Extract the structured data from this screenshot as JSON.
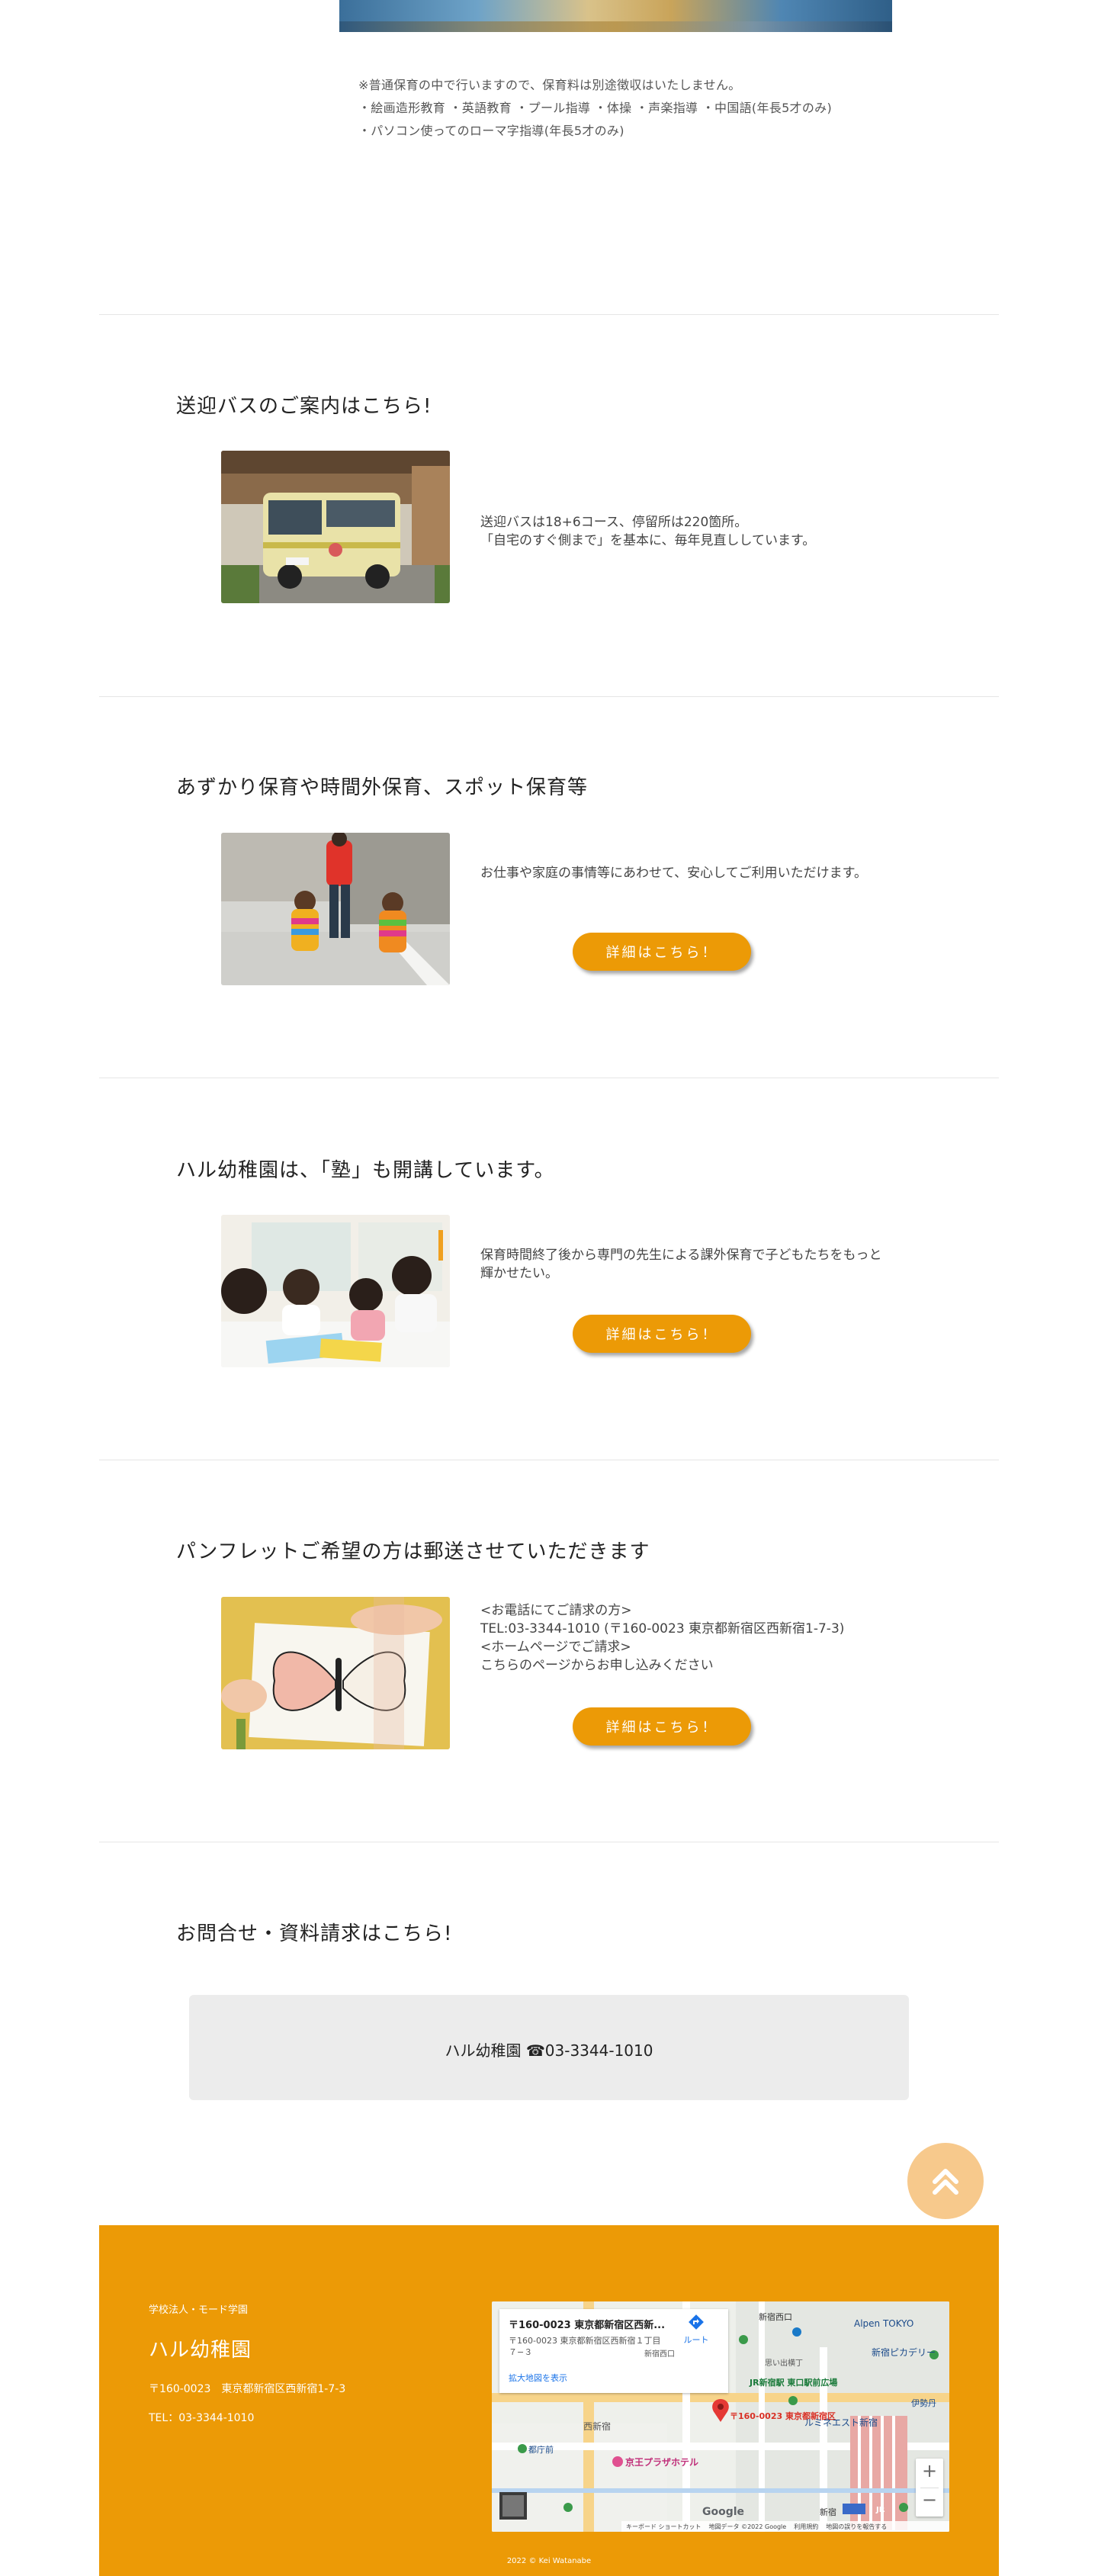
{
  "notes": [
    "※普通保育の中で行いますので、保育料は別途徴収はいたしません。",
    "・絵画造形教育 ・英語教育 ・プール指導 ・体操 ・声楽指導 ・中国語(年長5才のみ)",
    "・パソコン使ってのローマ字指導(年長5才のみ)"
  ],
  "sections": [
    {
      "title": "送迎バスのご案内はこちら!",
      "description": "送迎バスは18+6コース、停留所は220箇所。\n「自宅のすぐ側まで」を基本に、毎年見直ししています。"
    },
    {
      "title": "あずかり保育や時間外保育、スポット保育等",
      "description": "お仕事や家庭の事情等にあわせて、安心してご利用いただけます。",
      "button": "詳細はこちら！"
    },
    {
      "title": "ハル幼稚園は、「塾」も開講しています。",
      "description": "保育時間終了後から専門の先生による課外保育で子どもたちをもっと輝かせたい。",
      "button": "詳細はこちら！"
    },
    {
      "title": "パンフレットご希望の方は郵送させていただきます",
      "description": "<お電話にてご請求の方>\nTEL:03-3344-1010 (〒160-0023 東京都新宿区西新宿1-7-3)\n<ホームページでご請求>\nこちらのページからお申し込みください",
      "button": "詳細はこちら！"
    }
  ],
  "contact": {
    "title": "お問合せ・資料請求はこちら!",
    "text": "ハル幼稚園 ☎03-3344-1010"
  },
  "footer": {
    "org": "学校法人・モード学園",
    "name": "ハル幼稚園",
    "address": "〒160-0023　東京都新宿区西新宿1-7-3",
    "tel": "TEL：03-3344-1010",
    "copyright": "2022 © Kei Watanabe"
  },
  "map": {
    "card_title": "〒160-0023 東京都新宿区西新...",
    "card_address": "〒160-0023 東京都新宿区西新宿１丁目７−３",
    "route_label": "ルート",
    "enlarge_link": "拡大地図を表示",
    "pin_label": "〒160-0023 東京都新宿区",
    "labels": [
      "Alpen TOKYO",
      "新宿ピカデリー",
      "新宿西口",
      "JR新宿駅 東口駅前広場",
      "ルミネエスト新宿",
      "伊勢丹",
      "西新宿",
      "京王プラザホテル",
      "都庁前",
      "新宿",
      "思い出横丁",
      "新宿西口",
      "JR"
    ],
    "zoom_in": "+",
    "zoom_out": "−",
    "attribution": [
      "キーボード ショートカット",
      "地図データ ©2022 Google",
      "利用規約",
      "地図の誤りを報告する"
    ],
    "google": "Google"
  },
  "colors": {
    "accent": "#ec9a06",
    "scroll_top": "#f7c98c",
    "contact_box": "#ececec"
  }
}
